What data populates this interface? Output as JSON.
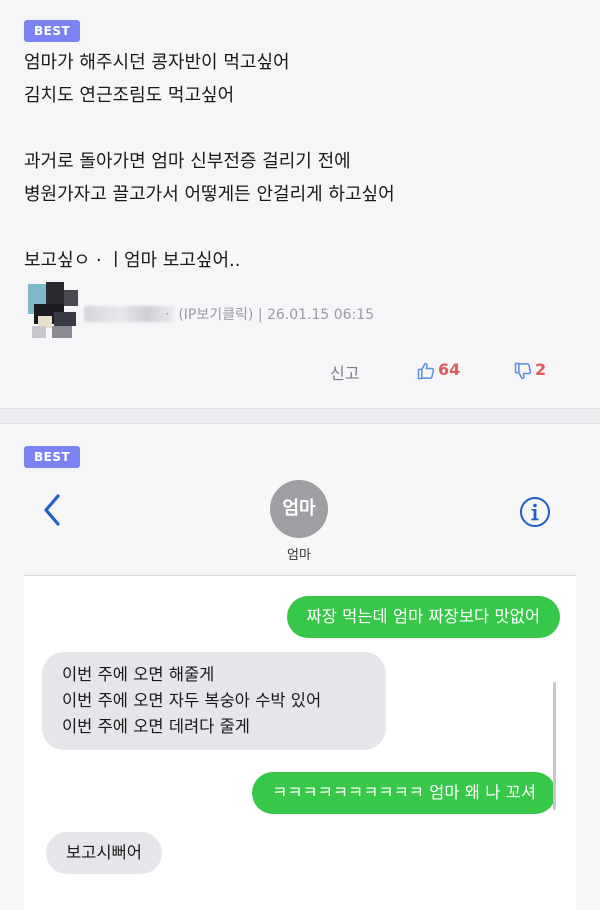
{
  "post1": {
    "badge": "BEST",
    "lines": [
      "엄마가 해주시던 콩자반이 먹고싶어",
      "김치도 연근조림도 먹고싶어",
      "",
      "과거로 돌아가면 엄마 신부전증 걸리기 전에",
      "병원가자고 끌고가서 어떻게든 안걸리게 하고싶어",
      "",
      "보고싶ㅇ · ㅣ엄마 보고싶어.."
    ],
    "author_suffix": "ㆍ",
    "ip_link": "(IP보기클릭)",
    "timestamp": "| 26.01.15 06:15",
    "report_label": "신고",
    "like_count": "64",
    "dislike_count": "2",
    "colors": {
      "badge": "#7b83f2",
      "vote": "#e05a5a"
    }
  },
  "post2": {
    "badge": "BEST",
    "contact_initials": "엄마",
    "contact_name": "엄마",
    "messages": [
      {
        "from": "me",
        "text": "짜장 먹는데 엄마 짜장보다 맛없어"
      },
      {
        "from": "mom",
        "lines": [
          "이번 주에 오면 해줄게",
          "이번 주에 오면 자두 복숭아 수박 있어",
          "이번 주에 오면 데려다 줄게"
        ]
      },
      {
        "from": "me",
        "text": "ㅋㅋㅋㅋㅋㅋㅋㅋㅋㅋ 엄마 왜 나 꼬셔"
      },
      {
        "from": "mom",
        "text": "보고시뻐어"
      }
    ],
    "icons": [
      "back-chevron-icon",
      "info-icon"
    ],
    "colors": {
      "outgoing": "#37c849",
      "incoming": "#e6e6ea",
      "ios_blue": "#1e5fc8"
    }
  }
}
